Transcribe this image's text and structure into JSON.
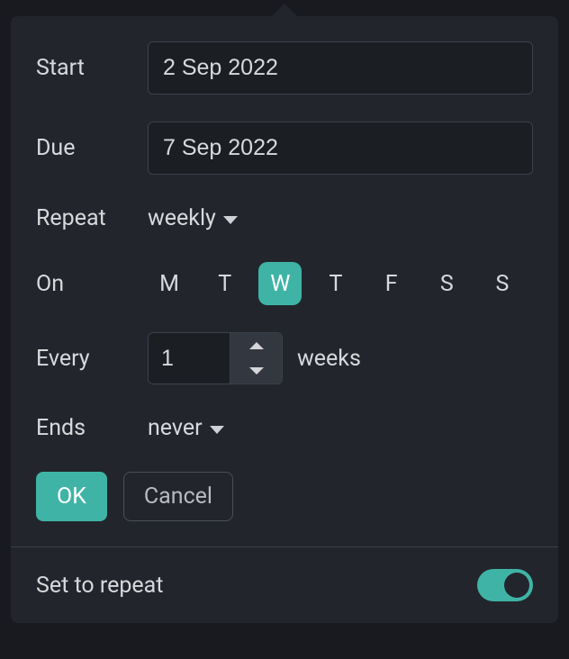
{
  "start": {
    "label": "Start",
    "value": "2 Sep 2022"
  },
  "due": {
    "label": "Due",
    "value": "7 Sep 2022"
  },
  "repeat": {
    "label": "Repeat",
    "value": "weekly"
  },
  "on": {
    "label": "On",
    "days": [
      "M",
      "T",
      "W",
      "T",
      "F",
      "S",
      "S"
    ],
    "selected_index": 2
  },
  "every": {
    "label": "Every",
    "value": "1",
    "unit": "weeks"
  },
  "ends": {
    "label": "Ends",
    "value": "never"
  },
  "actions": {
    "ok": "OK",
    "cancel": "Cancel"
  },
  "footer": {
    "label": "Set to repeat",
    "toggle_on": true
  },
  "colors": {
    "accent": "#3fb4a6"
  }
}
